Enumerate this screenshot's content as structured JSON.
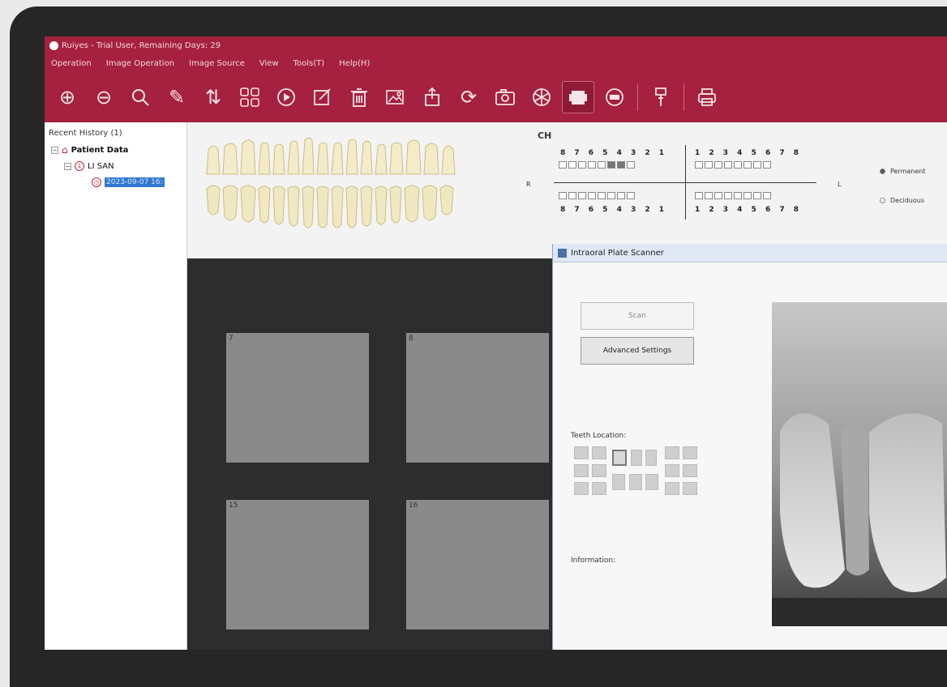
{
  "window": {
    "title": "Ruiyes - Trial User, Remaining Days: 29"
  },
  "menu": {
    "items": [
      "Operation",
      "Image Operation",
      "Image Source",
      "View",
      "Tools(T)",
      "Help(H)"
    ]
  },
  "toolbar": {
    "icons": [
      "zoom-in-icon",
      "zoom-out-icon",
      "search-icon",
      "pencil-icon",
      "sort-icon",
      "grid-icon",
      "play-icon",
      "edit-icon",
      "trash-icon",
      "gallery-icon",
      "export-icon",
      "refresh-icon",
      "camera-icon",
      "aperture-icon",
      "scanner-icon",
      "sensor-icon",
      "handpiece-icon",
      "print-icon"
    ]
  },
  "sidebar": {
    "header": "Recent History (1)",
    "root": "Patient Data",
    "patient": "LI SAN",
    "session": "2023-09-07 16:"
  },
  "chart": {
    "label": "CH",
    "upper_left": "8 7 6 5 4 3 2 1",
    "upper_right": "1 2 3 4 5 6 7 8",
    "lower_left": "8 7 6 5 4 3 2 1",
    "lower_right": "1 2 3 4 5 6 7 8",
    "side_right": "R",
    "side_left": "L",
    "upper_checked": [
      5,
      6
    ],
    "permanent": "Permanent",
    "deciduous": "Deciduous"
  },
  "viewer": {
    "slots": [
      "7",
      "8",
      "15",
      "16"
    ]
  },
  "scanner": {
    "title": "Intraoral Plate Scanner",
    "scan_label": "Scan",
    "advanced_label": "Advanced Settings",
    "teeth_location_label": "Teeth Location:",
    "information_label": "Information:"
  }
}
